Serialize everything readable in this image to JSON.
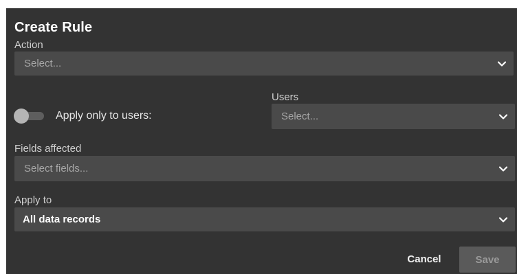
{
  "dialog": {
    "title": "Create Rule",
    "action": {
      "label": "Action",
      "placeholder": "Select..."
    },
    "apply_only": {
      "toggle_label": "Apply only to users:",
      "enabled": false
    },
    "users": {
      "label": "Users",
      "placeholder": "Select..."
    },
    "fields": {
      "label": "Fields affected",
      "placeholder": "Select fields..."
    },
    "apply_to": {
      "label": "Apply to",
      "value": "All data records"
    },
    "buttons": {
      "cancel": "Cancel",
      "save": "Save"
    }
  },
  "icons": {
    "dropdown": "chevron-down-icon"
  },
  "colors": {
    "dialog_bg": "#333333",
    "field_bg": "#4a4a4a",
    "save_bg": "#5a5a5a",
    "text_primary": "#ffffff",
    "text_muted": "#a6a6a6"
  }
}
